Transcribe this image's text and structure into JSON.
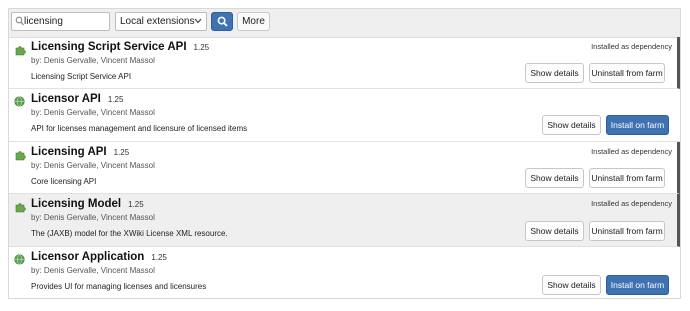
{
  "toolbar": {
    "search_value": "licensing",
    "search_icon": "magnifier-icon",
    "filter_selected": "Local extensions",
    "search_button_icon": "search-icon",
    "more_label": "More"
  },
  "colors": {
    "primary": "#3e72b0",
    "toolbar_bg": "#efefef",
    "hover_row_bg": "#efefef",
    "dependency_marker": "#555555",
    "puzzle_icon": "#6aa84f",
    "globe_icon": "#5fa35a"
  },
  "extensions": [
    {
      "name": "Licensing Script Service API",
      "version": "1.25",
      "authors": "by: Denis Gervalle, Vincent Massol",
      "description": "Licensing Script Service API",
      "icon": "puzzle-icon",
      "status": "Installed as dependency",
      "details_label": "Show details",
      "action_label": "Uninstall from farm"
    },
    {
      "name": "Licensor API",
      "version": "1.25",
      "authors": "by: Denis Gervalle, Vincent Massol",
      "description": "API for licenses management and licensure of licensed items",
      "icon": "globe-icon",
      "status": "",
      "details_label": "Show details",
      "action_label": "Install on farm"
    },
    {
      "name": "Licensing API",
      "version": "1.25",
      "authors": "by: Denis Gervalle, Vincent Massol",
      "description": "Core licensing API",
      "icon": "puzzle-icon",
      "status": "Installed as dependency",
      "details_label": "Show details",
      "action_label": "Uninstall from farm"
    },
    {
      "name": "Licensing Model",
      "version": "1.25",
      "authors": "by: Denis Gervalle, Vincent Massol",
      "description": "The (JAXB) model for the XWiki License XML resource.",
      "icon": "puzzle-icon",
      "status": "Installed as dependency",
      "details_label": "Show details",
      "action_label": "Uninstall from farm"
    },
    {
      "name": "Licensor Application",
      "version": "1.25",
      "authors": "by: Denis Gervalle, Vincent Massol",
      "description": "Provides UI for managing licenses and licensures",
      "icon": "globe-icon",
      "status": "",
      "details_label": "Show details",
      "action_label": "Install on farm"
    }
  ]
}
